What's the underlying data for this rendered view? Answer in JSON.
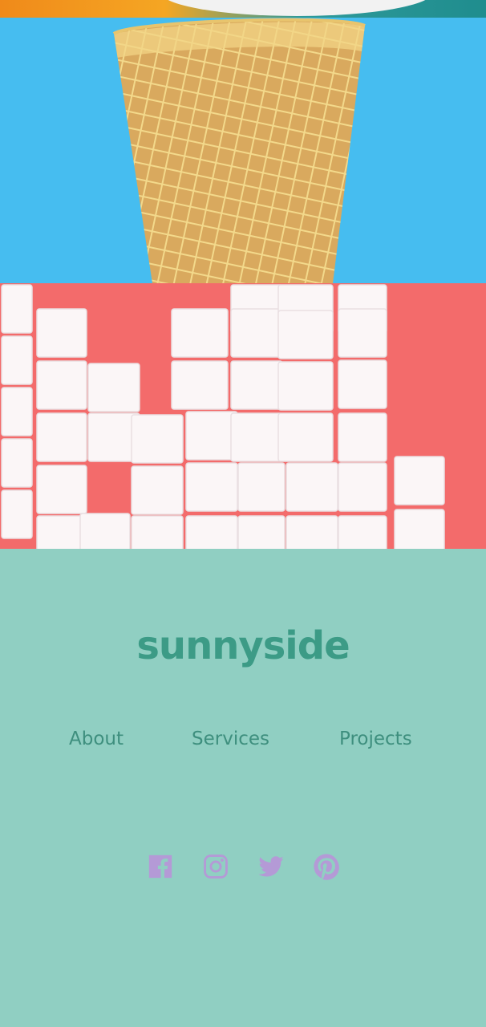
{
  "brand": {
    "logo_text": "sunnyside",
    "color": "#3c9b86"
  },
  "footer": {
    "background": "#90cfc2",
    "nav": {
      "about": "About",
      "services": "Services",
      "projects": "Projects"
    },
    "social_icons": [
      "facebook-icon",
      "instagram-icon",
      "twitter-icon",
      "pinterest-icon"
    ],
    "social_color": "#b49ad6"
  },
  "gallery": {
    "images": [
      "orange-dessert-image",
      "ice-cream-cone-image",
      "sugar-cubes-image"
    ],
    "colors": {
      "blue": "#46bdf0",
      "coral": "#f36b6b"
    }
  }
}
